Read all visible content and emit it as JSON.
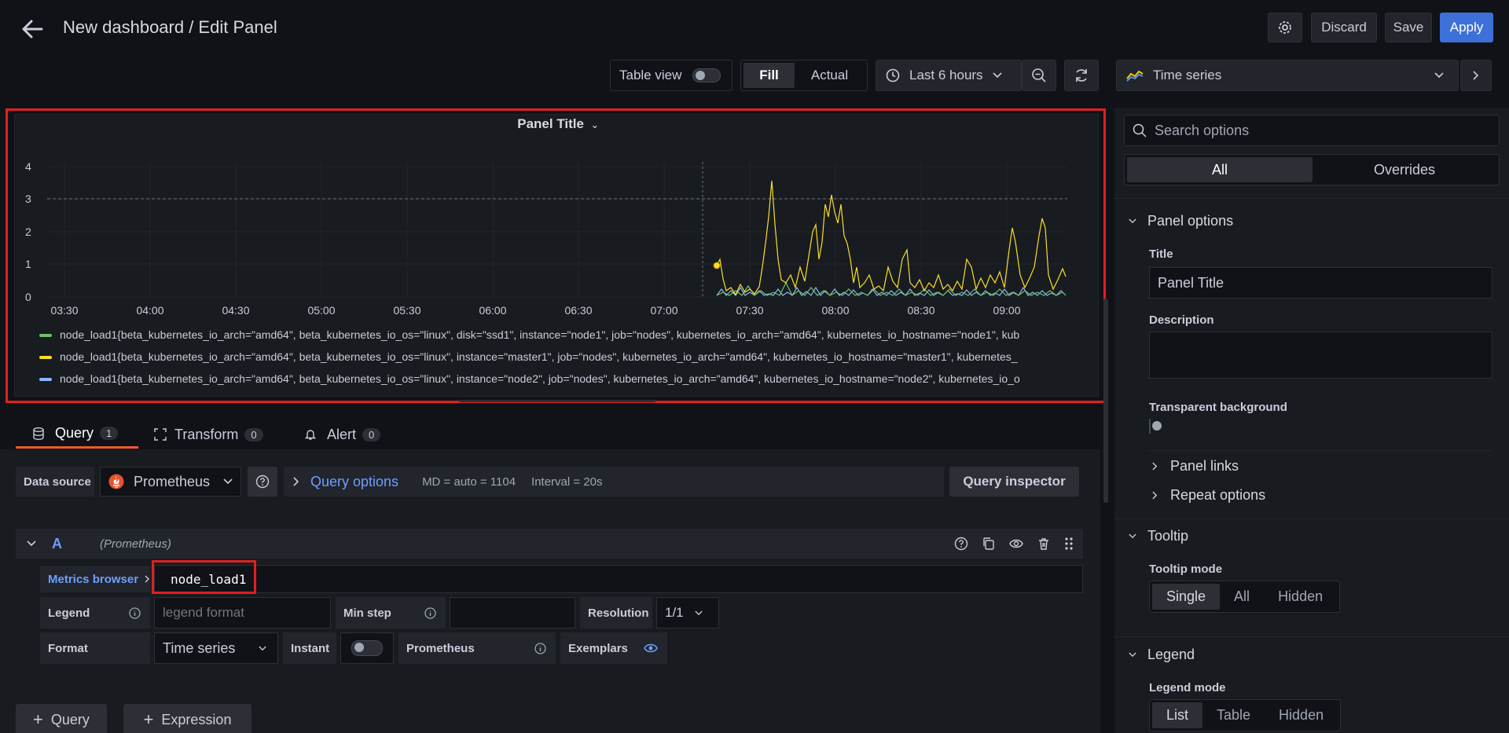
{
  "header": {
    "title": "New dashboard / Edit Panel",
    "discard_label": "Discard",
    "save_label": "Save",
    "apply_label": "Apply"
  },
  "toolbar": {
    "table_view_label": "Table view",
    "fill_label": "Fill",
    "actual_label": "Actual",
    "time_range_label": "Last 6 hours",
    "visualization_label": "Time series"
  },
  "panel": {
    "title": "Panel Title",
    "y_ticks": [
      "4",
      "3",
      "2",
      "1",
      "0"
    ],
    "x_ticks": [
      "03:30",
      "04:00",
      "04:30",
      "05:00",
      "05:30",
      "06:00",
      "06:30",
      "07:00",
      "07:30",
      "08:00",
      "08:30",
      "09:00"
    ],
    "legend": [
      {
        "color": "#73bf69",
        "text": "node_load1{beta_kubernetes_io_arch=\"amd64\", beta_kubernetes_io_os=\"linux\", disk=\"ssd1\", instance=\"node1\", job=\"nodes\", kubernetes_io_arch=\"amd64\", kubernetes_io_hostname=\"node1\", kub"
      },
      {
        "color": "#fade2a",
        "text": "node_load1{beta_kubernetes_io_arch=\"amd64\", beta_kubernetes_io_os=\"linux\", instance=\"master1\", job=\"nodes\", kubernetes_io_arch=\"amd64\", kubernetes_io_hostname=\"master1\", kubernetes_"
      },
      {
        "color": "#8ab8ff",
        "text": "node_load1{beta_kubernetes_io_arch=\"amd64\", beta_kubernetes_io_os=\"linux\", instance=\"node2\", job=\"nodes\", kubernetes_io_arch=\"amd64\", kubernetes_io_hostname=\"node2\", kubernetes_io_o"
      }
    ]
  },
  "tabs": {
    "query_label": "Query",
    "query_count": "1",
    "transform_label": "Transform",
    "transform_count": "0",
    "alert_label": "Alert",
    "alert_count": "0"
  },
  "query_bar": {
    "data_source_label": "Data source",
    "data_source_value": "Prometheus",
    "query_options_label": "Query options",
    "md_text": "MD = auto = 1104",
    "interval_text": "Interval = 20s",
    "inspector_label": "Query inspector"
  },
  "query_a": {
    "ref_id": "A",
    "source_hint": "(Prometheus)",
    "metrics_browser_label": "Metrics browser",
    "metric_value": "node_load1",
    "legend_label": "Legend",
    "legend_placeholder": "legend format",
    "min_step_label": "Min step",
    "resolution_label": "Resolution",
    "resolution_value": "1/1",
    "format_label": "Format",
    "format_value": "Time series",
    "instant_label": "Instant",
    "prometheus_label": "Prometheus",
    "exemplars_label": "Exemplars"
  },
  "add_buttons": {
    "query_label": "Query",
    "expression_label": "Expression"
  },
  "options": {
    "search_placeholder": "Search options",
    "tab_all": "All",
    "tab_overrides": "Overrides",
    "panel_options_title": "Panel options",
    "title_label": "Title",
    "title_value": "Panel Title",
    "description_label": "Description",
    "transparent_label": "Transparent background",
    "panel_links_label": "Panel links",
    "repeat_options_label": "Repeat options",
    "tooltip_title": "Tooltip",
    "tooltip_mode_label": "Tooltip mode",
    "tooltip_modes": [
      "Single",
      "All",
      "Hidden"
    ],
    "legend_title": "Legend",
    "legend_mode_label": "Legend mode",
    "legend_modes": [
      "List",
      "Table",
      "Hidden"
    ]
  }
}
